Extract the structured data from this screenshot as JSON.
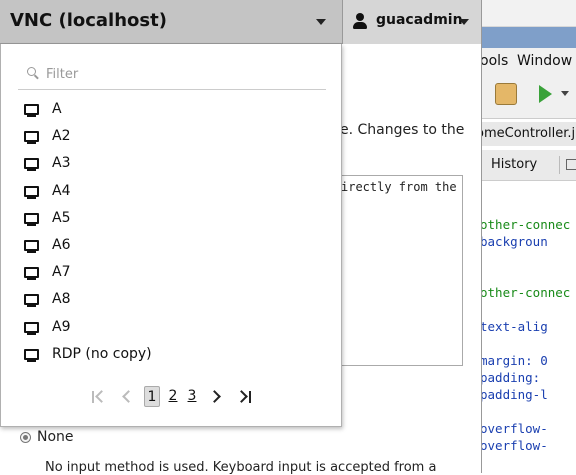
{
  "topbar": {
    "connection_title": "VNC (localhost)",
    "username": "guacadmin"
  },
  "dropdown": {
    "filter_placeholder": "Filter",
    "connections": [
      {
        "name": "A",
        "icon": "monitor-icon"
      },
      {
        "name": "A2",
        "icon": "monitor-icon"
      },
      {
        "name": "A3",
        "icon": "monitor-icon"
      },
      {
        "name": "A4",
        "icon": "monitor-icon"
      },
      {
        "name": "A5",
        "icon": "monitor-icon"
      },
      {
        "name": "A6",
        "icon": "monitor-icon"
      },
      {
        "name": "A7",
        "icon": "monitor-icon"
      },
      {
        "name": "A8",
        "icon": "monitor-icon"
      },
      {
        "name": "A9",
        "icon": "monitor-icon"
      },
      {
        "name": "RDP (no copy)",
        "icon": "monitor-icon"
      }
    ],
    "pager": {
      "pages": [
        "1",
        "2",
        "3"
      ],
      "current_page": "1"
    }
  },
  "background": {
    "text_fragment": "e. Changes to the",
    "textarea_fragment": "irectly from the",
    "radio_label": "None",
    "description": "No input method is used. Keyboard input is accepted from a"
  },
  "remote_ide": {
    "menu": [
      "ools",
      "Window"
    ],
    "file_tab": "omeController.j",
    "history_tab": "History",
    "code_lines": [
      {
        "text": "other-connec",
        "color": "green"
      },
      {
        "text": "   backgroun",
        "color": "blue"
      },
      {
        "text": "other-connec",
        "color": "green"
      },
      {
        "text": "   text-alig",
        "color": "blue"
      },
      {
        "text": "   margin: 0",
        "color": "blue"
      },
      {
        "text": "   padding: ",
        "color": "blue"
      },
      {
        "text": "   padding-l",
        "color": "blue"
      },
      {
        "text": "   overflow-",
        "color": "blue"
      },
      {
        "text": "   overflow-",
        "color": "blue"
      }
    ]
  },
  "colors": {
    "topbar_bg": "#c4c4c4",
    "user_menu_bg": "#d6d6d6",
    "code_green": "#188a18",
    "code_blue": "#1a3fb0"
  }
}
